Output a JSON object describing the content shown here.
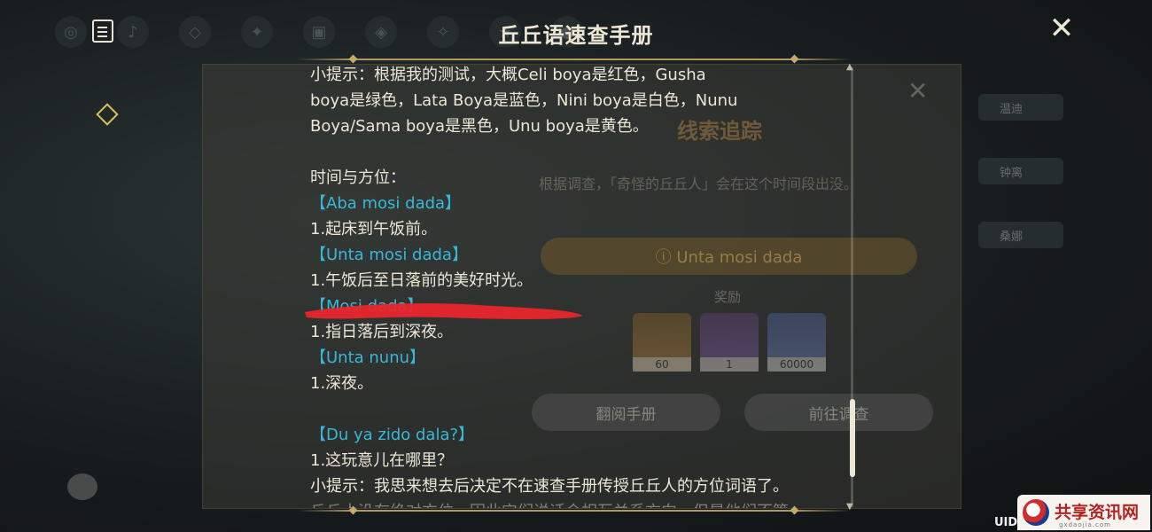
{
  "header": {
    "title": "丘丘语速查手册"
  },
  "background": {
    "panel_title": "线索追踪",
    "panel_desc": "根据调查，「奇怪的丘丘人」会在这个时间段出没。",
    "track_label": "ⓘ Unta mosi dada",
    "reward_label": "奖励",
    "rewards": [
      {
        "count": "60"
      },
      {
        "count": "1"
      },
      {
        "count": "60000"
      }
    ],
    "button_browse": "翻阅手册",
    "button_goto": "前往调查",
    "side_items": [
      "温迪",
      "钟离",
      "桑娜"
    ]
  },
  "content": {
    "tip1_line1": "小提示：根据我的测试，大概Celi boya是红色，Gusha",
    "tip1_line2": "boya是绿色，Lata Boya是蓝色，Nini boya是白色，Nunu",
    "tip1_line3": "Boya/Sama boya是黑色，Unu boya是黄色。",
    "section_time": "时间与方位：",
    "term1": "【Aba mosi dada】",
    "def1": "1.起床到午饭前。",
    "term2": "【Unta mosi dada】",
    "def2": "1.午饭后至日落前的美好时光。",
    "term3": "【Mosi dada】",
    "def3": "1.指日落后到深夜。",
    "term4": "【Unta nunu】",
    "def4": "1.深夜。",
    "term5": "【Du ya zido dala?】",
    "def5": "1.这玩意儿在哪里？",
    "tip2": "小提示：我思来想去后决定不在速查手册传授丘丘人的方位词语了。",
    "tip3_cut": "丘丘人没有绝对方位，因此它们说话会相互关系方向，但是他们不管"
  },
  "footer": {
    "uid_label": "UID:"
  },
  "watermark": {
    "text": "共享资讯网",
    "sub": "gxdaojia.com"
  },
  "colors": {
    "highlight": "#38b8d8",
    "redaction": "#e8262c",
    "text": "#ece6d5"
  }
}
